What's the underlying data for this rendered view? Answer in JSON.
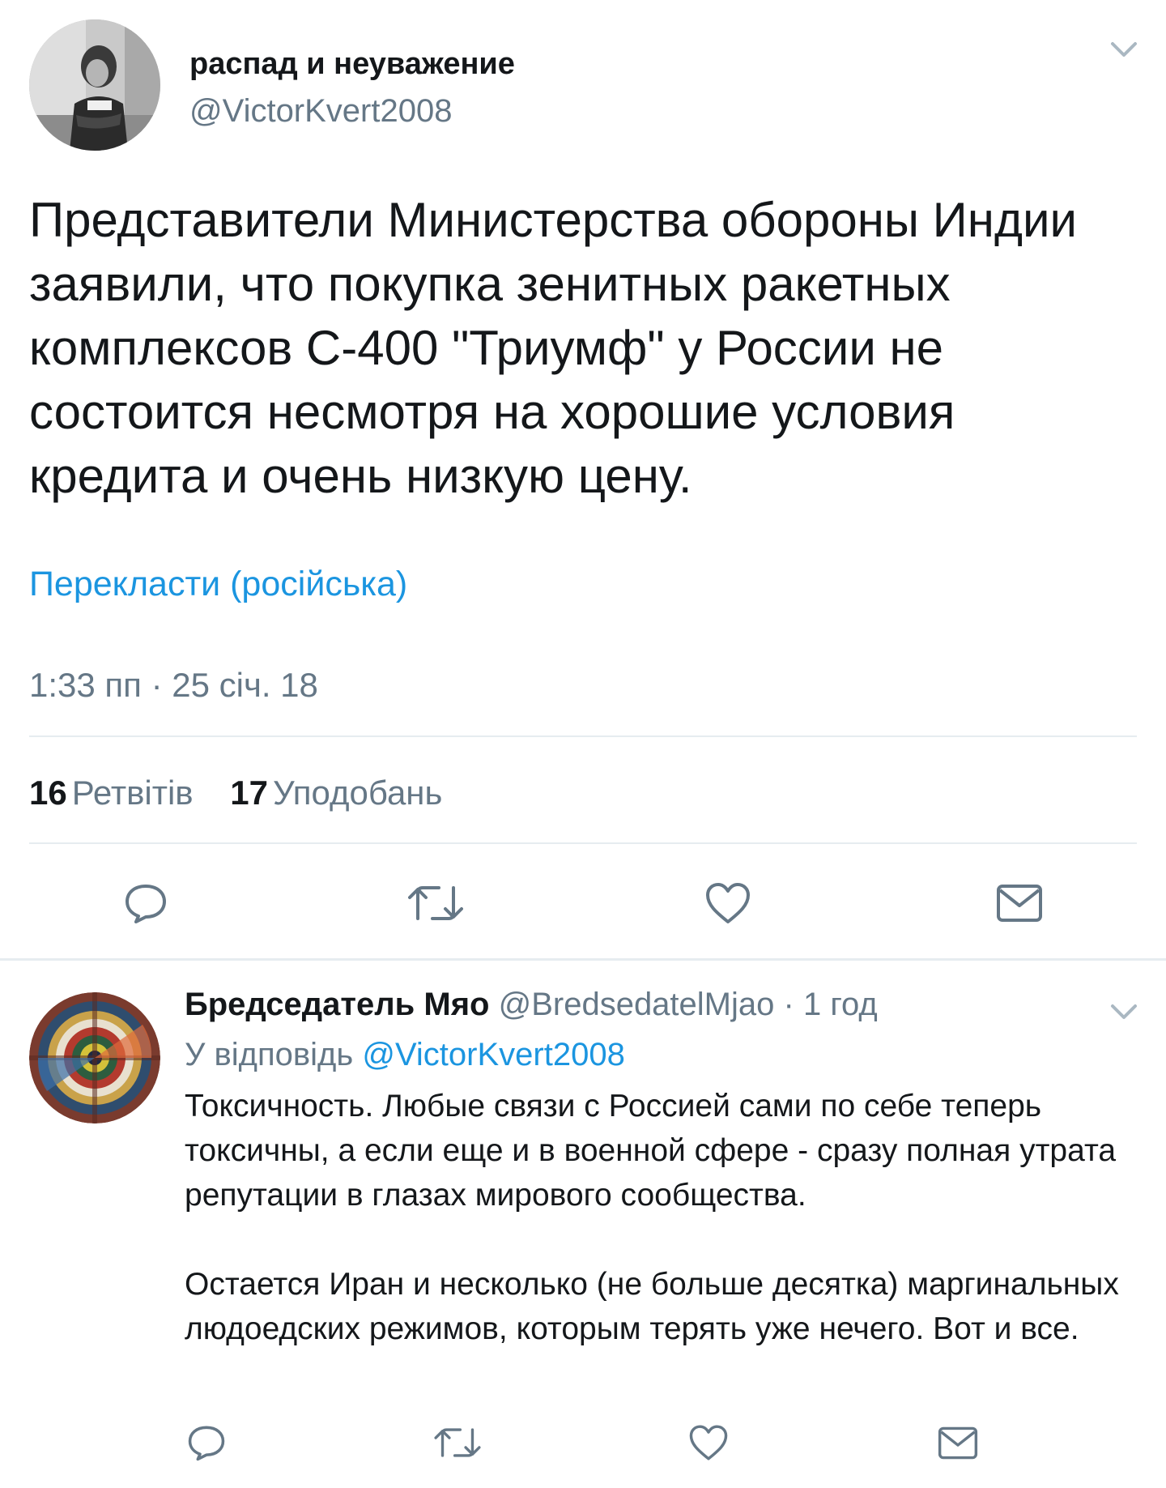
{
  "tweet": {
    "author_name": "распад и неуважение",
    "author_handle": "@VictorKvert2008",
    "text": "Представители Министерства обороны Индии заявили, что покупка зенитных ракетных комплексов С-400 \"Триумф\" у России не состоится несмотря на хорошие условия кредита и очень низкую цену.",
    "translate_link": "Перекласти (російська)",
    "timestamp": "1:33 пп · 25 січ. 18",
    "retweets_count": "16",
    "retweets_label": "Ретвітів",
    "likes_count": "17",
    "likes_label": "Уподобань"
  },
  "reply": {
    "author_name": "Бредседатель Мяо",
    "author_handle": "@BredsedatelMjao",
    "separator": "·",
    "time": "1 год",
    "reply_to_prefix": "У відповідь",
    "reply_to_handle": "@VictorKvert2008",
    "paragraphs": [
      "Токсичность. Любые связи с Россией сами по себе теперь токсичны, а если еще и в военной сфере - сразу полная утрата репутации в глазах мирового сообщества.",
      "Остается Иран и несколько (не больше десятка) маргинальных людоедских режимов, которым терять уже нечего. Вот и все."
    ]
  },
  "icons": {
    "reply": "reply-icon",
    "retweet": "retweet-icon",
    "like": "heart-icon",
    "share": "envelope-icon",
    "more": "chevron-down-icon"
  },
  "colors": {
    "link": "#1b95e0",
    "secondary_text": "#657786",
    "primary_text": "#14171a",
    "divider": "#e6ecf0"
  }
}
